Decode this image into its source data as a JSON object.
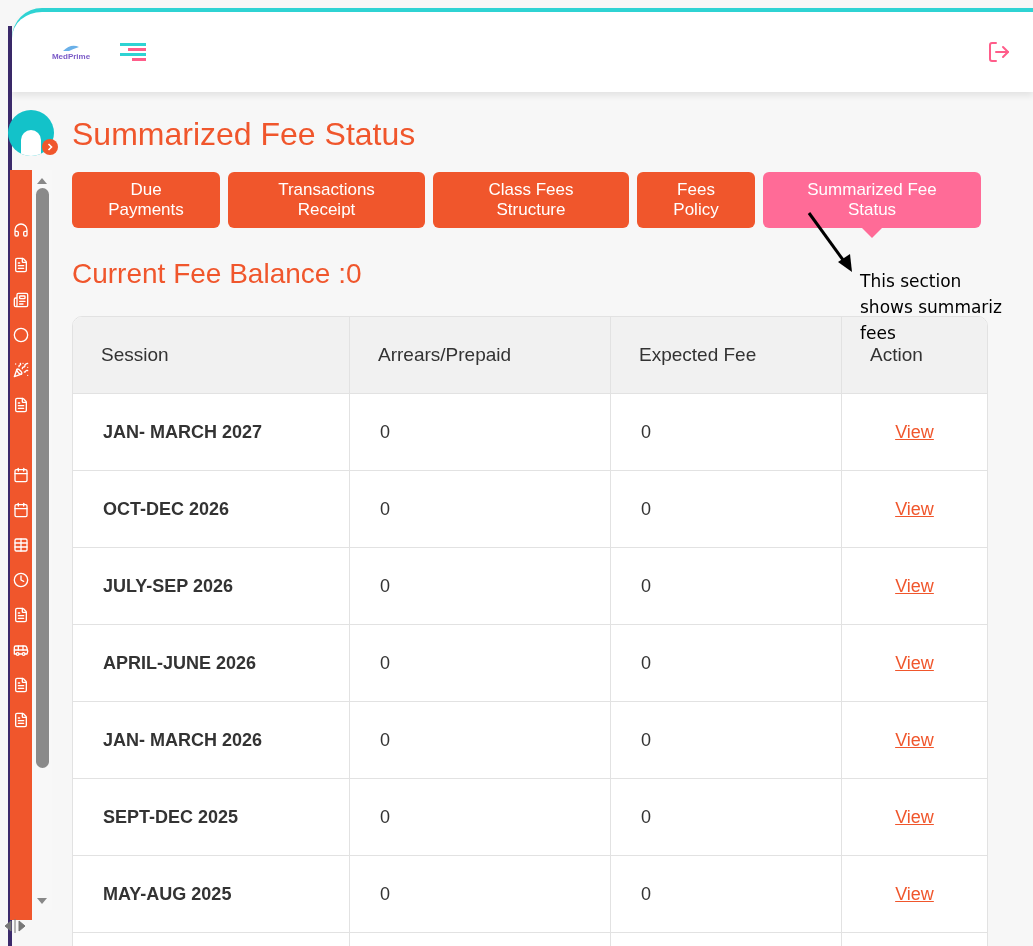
{
  "header": {
    "logo": "MedPrime"
  },
  "page_title": "Summarized Fee Status",
  "tabs": [
    {
      "label": "Due Payments",
      "selected": false
    },
    {
      "label": "Transactions Receipt",
      "selected": false
    },
    {
      "label": "Class Fees Structure",
      "selected": false
    },
    {
      "label": "Fees Policy",
      "selected": false
    },
    {
      "label": "Summarized Fee Status",
      "selected": true
    }
  ],
  "annotation": "This section shows summariz fees",
  "balance": "Current Fee Balance :0",
  "table": {
    "columns": [
      "Session",
      "Arrears/Prepaid",
      "Expected Fee",
      "Action"
    ],
    "rows": [
      [
        "JAN- MARCH 2027",
        "0",
        "0",
        "View"
      ],
      [
        "OCT-DEC 2026",
        "0",
        "0",
        "View"
      ],
      [
        "JULY-SEP 2026",
        "0",
        "0",
        "View"
      ],
      [
        "APRIL-JUNE 2026",
        "0",
        "0",
        "View"
      ],
      [
        "JAN- MARCH 2026",
        "0",
        "0",
        "View"
      ],
      [
        "SEPT-DEC 2025",
        "0",
        "0",
        "View"
      ],
      [
        "MAY-AUG 2025",
        "0",
        "0",
        "View"
      ]
    ]
  }
}
